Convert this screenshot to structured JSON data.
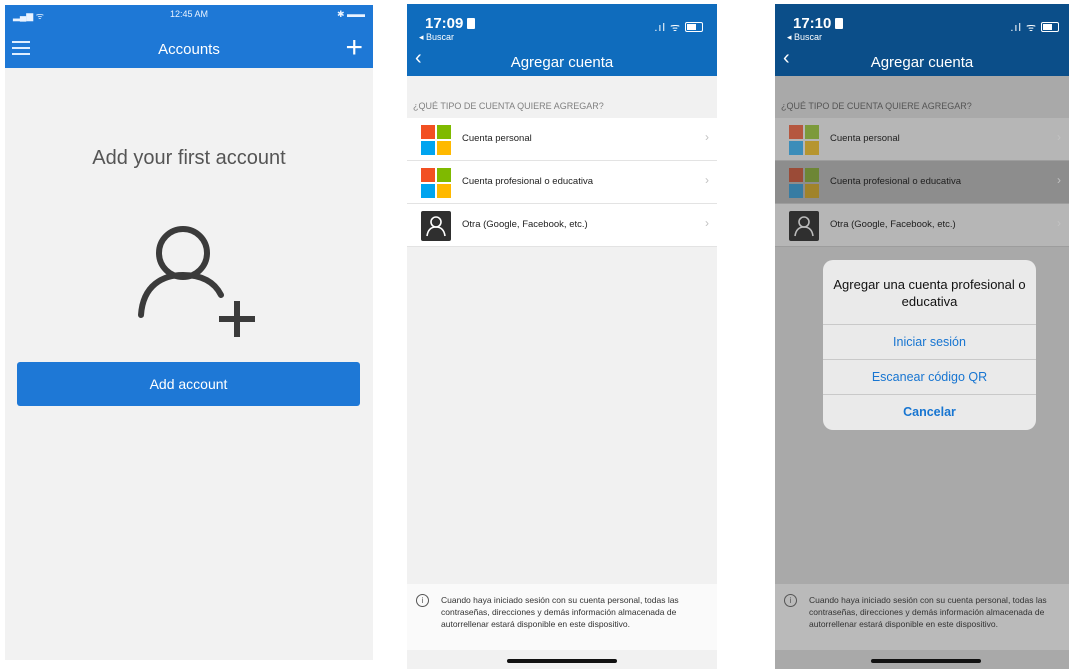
{
  "screen1": {
    "status": {
      "time": "12:45 AM"
    },
    "header": {
      "title": "Accounts",
      "add_glyph": "+"
    },
    "heading": "Add your first account",
    "add_button": "Add account",
    "icons": [
      "menu-icon",
      "plus-icon",
      "add-person-icon"
    ]
  },
  "screen2": {
    "status": {
      "time": "17:09",
      "back_app": "◂ Buscar"
    },
    "header": {
      "title": "Agregar cuenta"
    },
    "section": "¿QUÉ TIPO DE CUENTA QUIERE AGREGAR?",
    "rows": [
      {
        "label": "Cuenta personal",
        "icon": "microsoft-logo-icon"
      },
      {
        "label": "Cuenta profesional o educativa",
        "icon": "microsoft-logo-icon"
      },
      {
        "label": "Otra (Google, Facebook, etc.)",
        "icon": "person-icon"
      }
    ],
    "footer": "Cuando haya iniciado sesión con su cuenta personal, todas las contraseñas, direcciones y demás información almacenada de autorrellenar estará disponible en este dispositivo."
  },
  "screen3": {
    "status": {
      "time": "17:10",
      "back_app": "◂ Buscar"
    },
    "header": {
      "title": "Agregar cuenta"
    },
    "section": "¿QUÉ TIPO DE CUENTA QUIERE AGREGAR?",
    "rows": [
      {
        "label": "Cuenta personal"
      },
      {
        "label": "Cuenta profesional o educativa"
      },
      {
        "label": "Otra (Google, Facebook, etc.)"
      }
    ],
    "modal": {
      "title": "Agregar una cuenta profesional o educativa",
      "sign_in": "Iniciar sesión",
      "scan_qr": "Escanear código QR",
      "cancel": "Cancelar"
    },
    "footer": "Cuando haya iniciado sesión con su cuenta personal, todas las contraseñas, direcciones y demás información almacenada de autorrellenar estará disponible en este dispositivo."
  },
  "colors": {
    "accent": "#1e78d6",
    "header_blue": "#0f6cbd",
    "ms_red": "#f25022",
    "ms_green": "#7fba00",
    "ms_blue": "#00a4ef",
    "ms_yellow": "#ffb900"
  }
}
